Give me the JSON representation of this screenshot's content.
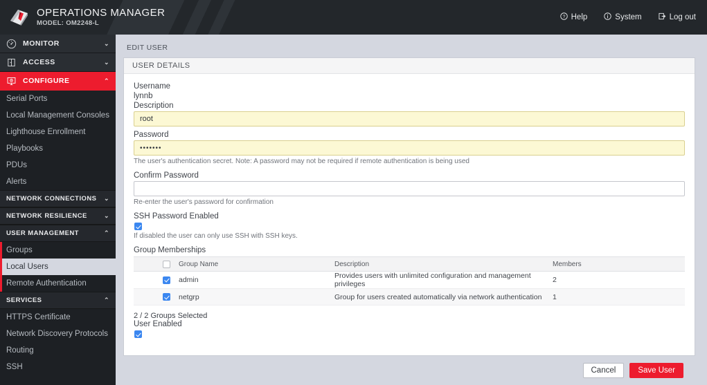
{
  "header": {
    "title": "OPERATIONS MANAGER",
    "model": "MODEL: OM2248-L",
    "logo_icon": "opengear-logo-icon",
    "nav": [
      {
        "label": "Help",
        "icon": "question-circle-icon"
      },
      {
        "label": "System",
        "icon": "info-circle-icon"
      },
      {
        "label": "Log out",
        "icon": "logout-arrow-icon"
      }
    ]
  },
  "sidebar": {
    "top": [
      {
        "label": "MONITOR",
        "icon": "gauge-icon",
        "chevron": "⌄",
        "active": false
      },
      {
        "label": "ACCESS",
        "icon": "door-icon",
        "chevron": "⌄",
        "active": false
      },
      {
        "label": "CONFIGURE",
        "icon": "monitor-gear-icon",
        "chevron": "⌃",
        "active": true
      }
    ],
    "configure_items": [
      {
        "label": "Serial Ports"
      },
      {
        "label": "Local Management Consoles"
      },
      {
        "label": "Lighthouse Enrollment"
      },
      {
        "label": "Playbooks"
      },
      {
        "label": "PDUs"
      },
      {
        "label": "Alerts"
      }
    ],
    "sections": [
      {
        "label": "NETWORK CONNECTIONS",
        "chevron": "⌄"
      },
      {
        "label": "NETWORK RESILIENCE",
        "chevron": "⌄"
      }
    ],
    "user_management": {
      "label": "USER MANAGEMENT",
      "chevron": "⌃"
    },
    "user_management_items": [
      {
        "label": "Groups",
        "selected": false
      },
      {
        "label": "Local Users",
        "selected": true
      },
      {
        "label": "Remote Authentication",
        "selected": false
      }
    ],
    "services": {
      "label": "SERVICES",
      "chevron": "⌃"
    },
    "services_items": [
      {
        "label": "HTTPS Certificate"
      },
      {
        "label": "Network Discovery Protocols"
      },
      {
        "label": "Routing"
      },
      {
        "label": "SSH"
      }
    ]
  },
  "main": {
    "breadcrumb": "EDIT USER",
    "panel_title": "USER DETAILS",
    "fields": {
      "username_label": "Username",
      "username_value": "lynnb",
      "description_label": "Description",
      "description_value": "root",
      "password_label": "Password",
      "password_value": "•••••••",
      "password_help": "The user's authentication secret. Note: A password may not be required if remote authentication is being used",
      "confirm_label": "Confirm Password",
      "confirm_value": "",
      "confirm_help": "Re-enter the user's password for confirmation",
      "ssh_label": "SSH Password Enabled",
      "ssh_help": "If disabled the user can only use SSH with SSH keys.",
      "groups_label": "Group Memberships",
      "selected_count": "2 / 2 Groups Selected",
      "user_enabled_label": "User Enabled"
    },
    "table": {
      "headers": [
        "",
        "Group Name",
        "Description",
        "Members"
      ],
      "rows": [
        {
          "checked": true,
          "name": "admin",
          "description": "Provides users with unlimited configuration and management privileges",
          "members": "2"
        },
        {
          "checked": true,
          "name": "netgrp",
          "description": "Group for users created automatically via network authentication",
          "members": "1"
        }
      ]
    },
    "buttons": {
      "cancel": "Cancel",
      "save": "Save User"
    }
  },
  "colors": {
    "brand_red": "#ed1c2e",
    "checkbox_blue": "#3b87f0",
    "autofill_yellow": "#fcf8d4"
  }
}
